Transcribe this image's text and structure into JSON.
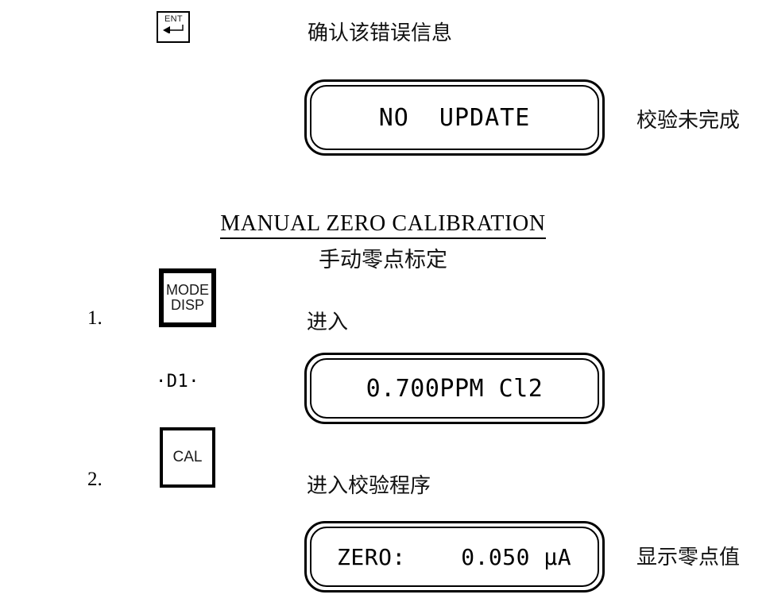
{
  "steps": [
    {
      "key": {
        "name": "ENT",
        "label": "ENT",
        "arrow_icon": "enter-arrow-icon"
      },
      "annotation": "确认该错误信息"
    },
    {
      "marker": "1.",
      "key": {
        "name": "MODE DISP",
        "line1": "MODE",
        "line2": "DISP"
      },
      "annotation": "进入"
    },
    {
      "marker": "2.",
      "key": {
        "name": "CAL",
        "label": "CAL"
      },
      "annotation": "进入校验程序"
    }
  ],
  "displays": [
    {
      "id": "no-update",
      "text": "NO  UPDATE",
      "align": "center",
      "side_note": "校验未完成"
    },
    {
      "id": "reading",
      "text": "0.700PPM Cl2",
      "align": "center",
      "side_note": "",
      "tag": "·D1·"
    },
    {
      "id": "zero",
      "text": "ZERO:    0.050 μA",
      "align": "left",
      "side_note": "显示零点值"
    }
  ],
  "heading": {
    "english": "MANUAL  ZERO  CALIBRATION",
    "chinese": "手动零点标定"
  },
  "colors": {
    "ink": "#000000",
    "text": "#111111",
    "background": "#ffffff"
  }
}
